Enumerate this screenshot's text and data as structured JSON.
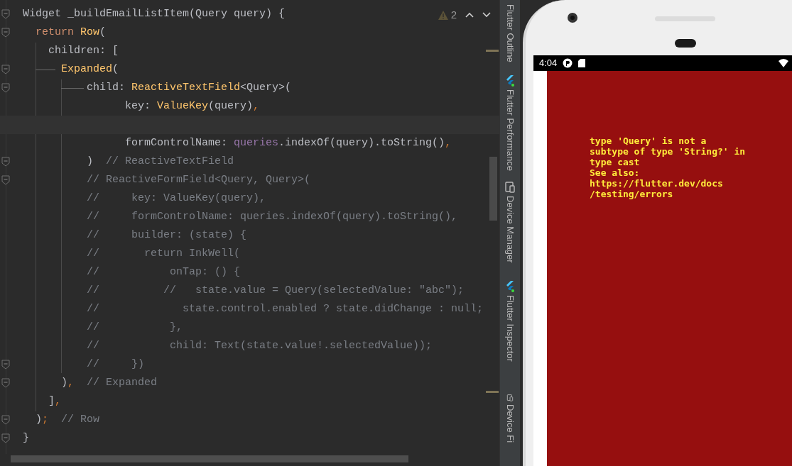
{
  "editor": {
    "warnings": "2",
    "lines": [
      {
        "fold": true,
        "current": false,
        "tokens": [
          {
            "kind": "plain",
            "text": "Widget _buildEmailListItem(Query query) {"
          }
        ]
      },
      {
        "fold": true,
        "current": false,
        "tokens": [
          {
            "kind": "keyword",
            "text": "  return "
          },
          {
            "kind": "type",
            "text": "Row"
          },
          {
            "kind": "plain",
            "text": "("
          }
        ]
      },
      {
        "current": false,
        "tokens": [
          {
            "kind": "plain",
            "text": "    children: ["
          }
        ]
      },
      {
        "fold": true,
        "current": false,
        "tokens": [
          {
            "kind": "type",
            "text": "      Expanded"
          },
          {
            "kind": "plain",
            "text": "("
          }
        ]
      },
      {
        "fold": true,
        "current": false,
        "tokens": [
          {
            "kind": "plain",
            "text": "          child: "
          },
          {
            "kind": "type",
            "text": "ReactiveTextField"
          },
          {
            "kind": "plain",
            "text": "<Query>("
          }
        ]
      },
      {
        "current": false,
        "tokens": [
          {
            "kind": "plain",
            "text": "                key: "
          },
          {
            "kind": "type",
            "text": "ValueKey"
          },
          {
            "kind": "plain",
            "text": "(query)"
          },
          {
            "kind": "punct",
            "text": ","
          }
        ]
      },
      {
        "current": true
      },
      {
        "current": false,
        "tokens": [
          {
            "kind": "plain",
            "text": "                formControlName: "
          },
          {
            "kind": "field",
            "text": "queries"
          },
          {
            "kind": "plain",
            "text": ".indexOf(query).toString()"
          },
          {
            "kind": "punct",
            "text": ","
          }
        ]
      },
      {
        "fold": true,
        "current": false,
        "tokens": [
          {
            "kind": "plain",
            "text": "          )"
          },
          {
            "kind": "comment",
            "text": "  // ReactiveTextField"
          }
        ]
      },
      {
        "fold": true,
        "current": false,
        "tokens": [
          {
            "kind": "comment",
            "text": "          // ReactiveFormField<Query, Query>("
          }
        ]
      },
      {
        "current": false,
        "tokens": [
          {
            "kind": "comment",
            "text": "          //     key: ValueKey(query),"
          }
        ]
      },
      {
        "current": false,
        "tokens": [
          {
            "kind": "comment",
            "text": "          //     formControlName: queries.indexOf(query).toString(),"
          }
        ]
      },
      {
        "current": false,
        "tokens": [
          {
            "kind": "comment",
            "text": "          //     builder: (state) {"
          }
        ]
      },
      {
        "current": false,
        "tokens": [
          {
            "kind": "comment",
            "text": "          //       return InkWell("
          }
        ]
      },
      {
        "current": false,
        "tokens": [
          {
            "kind": "comment",
            "text": "          //           onTap: () {"
          }
        ]
      },
      {
        "current": false,
        "tokens": [
          {
            "kind": "comment",
            "text": "          //          //   state.value = Query(selectedValue: \"abc\");"
          }
        ]
      },
      {
        "current": false,
        "tokens": [
          {
            "kind": "comment",
            "text": "          //             state.control.enabled ? state.didChange : null;"
          }
        ]
      },
      {
        "current": false,
        "tokens": [
          {
            "kind": "comment",
            "text": "          //           },"
          }
        ]
      },
      {
        "current": false,
        "tokens": [
          {
            "kind": "comment",
            "text": "          //           child: Text(state.value!.selectedValue));"
          }
        ]
      },
      {
        "fold": true,
        "current": false,
        "tokens": [
          {
            "kind": "comment",
            "text": "          //     })"
          }
        ]
      },
      {
        "fold": true,
        "current": false,
        "tokens": [
          {
            "kind": "plain",
            "text": "      )"
          },
          {
            "kind": "punct",
            "text": ","
          },
          {
            "kind": "comment",
            "text": "  // Expanded"
          }
        ]
      },
      {
        "current": false,
        "tokens": [
          {
            "kind": "plain",
            "text": "    ]"
          },
          {
            "kind": "punct",
            "text": ","
          }
        ]
      },
      {
        "fold": true,
        "current": false,
        "tokens": [
          {
            "kind": "plain",
            "text": "  )"
          },
          {
            "kind": "punct",
            "text": ";"
          },
          {
            "kind": "comment",
            "text": "  // Row"
          }
        ]
      },
      {
        "fold": true,
        "current": false,
        "tokens": [
          {
            "kind": "plain",
            "text": "}"
          }
        ]
      }
    ]
  },
  "tool_windows": [
    {
      "label": "Flutter Outline",
      "kind": "none"
    },
    {
      "label": "Flutter Performance",
      "kind": "flutter"
    },
    {
      "label": "Device Manager",
      "kind": "device"
    },
    {
      "label": "Flutter Inspector",
      "kind": "flutter"
    },
    {
      "label": "Device Fi",
      "kind": "device"
    }
  ],
  "phone": {
    "time": "4:04",
    "error_lines": [
      "type 'Query' is not a",
      "subtype of type 'String?' in",
      "type cast",
      "See also:",
      "https://flutter.dev/docs",
      "/testing/errors"
    ]
  }
}
